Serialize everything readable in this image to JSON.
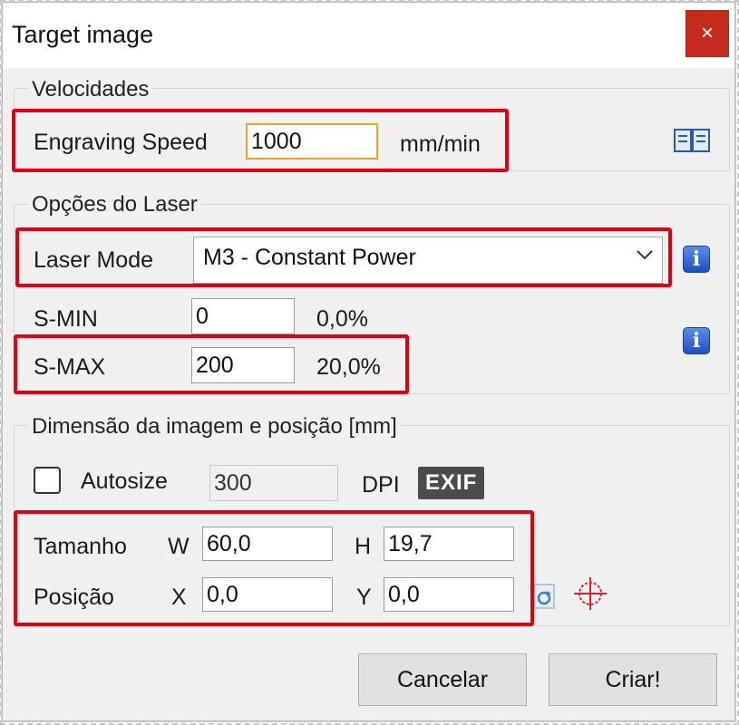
{
  "window": {
    "title": "Target image",
    "close_glyph": "×"
  },
  "velocidades": {
    "legend": "Velocidades",
    "engraving_speed_label": "Engraving Speed",
    "engraving_speed_value": "1000",
    "unit": "mm/min",
    "help_icon": "book-icon"
  },
  "laser": {
    "legend": "Opções do Laser",
    "mode_label": "Laser Mode",
    "mode_value": "M3 - Constant Power",
    "smin_label": "S-MIN",
    "smin_value": "0",
    "smin_pct": "0,0%",
    "smax_label": "S-MAX",
    "smax_value": "200",
    "smax_pct": "20,0%",
    "info_glyph": "i"
  },
  "dimensao": {
    "legend": "Dimensão da imagem e posição [mm]",
    "autosize_label": "Autosize",
    "autosize_checked": false,
    "dpi_value": "300",
    "dpi_label": "DPI",
    "exif_label": "EXIF",
    "tamanho_label": "Tamanho",
    "w_label": "W",
    "w_value": "60,0",
    "h_label": "H",
    "h_value": "19,7",
    "posicao_label": "Posição",
    "x_label": "X",
    "x_value": "0,0",
    "y_label": "Y",
    "y_value": "0,0"
  },
  "buttons": {
    "cancel": "Cancelar",
    "create": "Criar!"
  },
  "colors": {
    "highlight": "#e00010",
    "close_bg": "#c42b1c",
    "focus_border": "#f0a030"
  }
}
